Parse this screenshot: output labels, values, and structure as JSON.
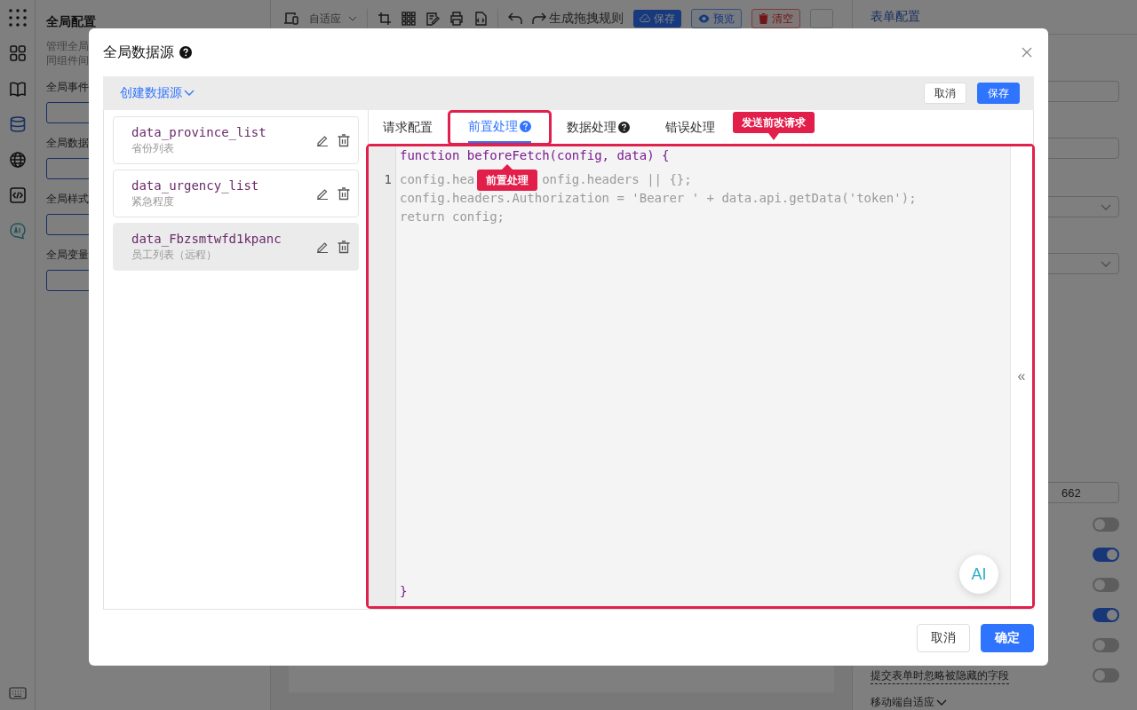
{
  "rail": {
    "items": [
      {
        "kind": "apps",
        "selected": false
      },
      {
        "kind": "grid",
        "selected": false
      },
      {
        "kind": "book",
        "selected": false
      },
      {
        "kind": "database",
        "selected": true
      },
      {
        "kind": "globe",
        "selected": false
      },
      {
        "kind": "code",
        "selected": false
      },
      {
        "kind": "ai",
        "selected": false
      }
    ],
    "bottom_items": [
      {
        "kind": "keyboard"
      }
    ]
  },
  "left_panel": {
    "title": "全局配置",
    "description": [
      "管理全局",
      "同组件间"
    ],
    "sections": [
      "全局事件",
      "全局数据",
      "全局样式",
      "全局变量"
    ]
  },
  "toolbar": {
    "layout": "自适应",
    "rule": "生成拖拽规则",
    "buttons": [
      {
        "kind": "primary",
        "label": "保存"
      },
      {
        "kind": "outline",
        "label": "预览"
      },
      {
        "kind": "danger",
        "label": "清空"
      }
    ]
  },
  "right_panel": {
    "title": "表单配置",
    "value": "662",
    "toggles": [
      {
        "on": false
      },
      {
        "on": true
      },
      {
        "on": false
      },
      {
        "on": true
      },
      {
        "on": false
      },
      {
        "on": false
      }
    ],
    "hidden_label": "提交表单时忽略被隐藏的字段",
    "mobile_label": "移动端自适应"
  },
  "modal": {
    "title": "全局数据源",
    "create": "创建数据源",
    "header_buttons": [
      {
        "kind": "default",
        "label": "取消"
      },
      {
        "kind": "primary",
        "label": "保存"
      }
    ],
    "sources": [
      {
        "name": "data_province_list",
        "description": "省份列表",
        "selected": false
      },
      {
        "name": "data_urgency_list",
        "description": "紧急程度",
        "selected": false
      },
      {
        "name": "data_Fbzsmtwfd1kpanc",
        "description": "员工列表（远程）",
        "selected": true
      }
    ],
    "tabs": [
      {
        "label": "请求配置",
        "selected": false,
        "help": false
      },
      {
        "label": "前置处理",
        "selected": true,
        "help": true
      },
      {
        "label": "数据处理",
        "selected": false,
        "help": true
      },
      {
        "label": "错误处理",
        "selected": false,
        "help": false
      }
    ],
    "code": [
      {
        "kind": "signature",
        "parts": [
          "function beforeFetch(config, data) {"
        ]
      },
      {
        "kind": "body",
        "number": "1",
        "parts": [
          "config.hea",
          "onfig.headers || {};"
        ]
      },
      {
        "kind": "body",
        "parts": [
          "config.headers.Authorization = 'Bearer ' + data.api.getData('token');"
        ]
      },
      {
        "kind": "body",
        "parts": [
          "return config;"
        ]
      },
      {
        "kind": "signature",
        "parts": [
          "}"
        ]
      }
    ],
    "collapse": "«",
    "ai": "AI",
    "annotations": [
      "前置处理",
      "发送前改请求"
    ],
    "footer_buttons": [
      {
        "kind": "default",
        "label": "取消"
      },
      {
        "kind": "primary",
        "label": "确定"
      }
    ]
  }
}
